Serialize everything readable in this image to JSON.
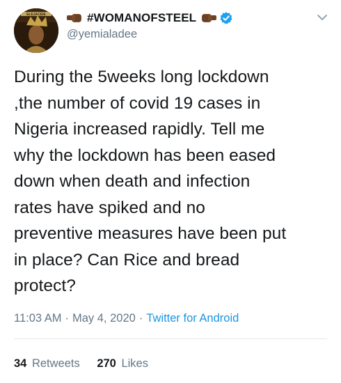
{
  "author": {
    "display_name": "#WOMANOFSTEEL",
    "handle": "@yemialadee",
    "avatar_text": "ELEJACEIE"
  },
  "tweet": {
    "text": "During the 5weeks long lockdown\n,the number of covid 19 cases in\nNigeria increased rapidly. Tell me\nwhy the lockdown has been eased\ndown when death and infection\nrates have spiked and no\npreventive measures have been put\nin place? Can Rice and bread\nprotect?"
  },
  "meta": {
    "time": "11:03 AM",
    "separator": "·",
    "date": "May 4, 2020",
    "source": "Twitter for Android"
  },
  "stats": {
    "retweets_count": "34",
    "retweets_label": "Retweets",
    "likes_count": "270",
    "likes_label": "Likes"
  },
  "icons": {
    "left_emoji": "fist-right-icon",
    "right_emoji": "fist-left-icon",
    "verified": "verified-badge-icon",
    "menu": "chevron-down-icon"
  },
  "colors": {
    "text": "#14171a",
    "secondary": "#657786",
    "link": "#1b95e0",
    "verified": "#1da1f2",
    "fist": "#6b4226",
    "divider": "#e1e8ed"
  }
}
